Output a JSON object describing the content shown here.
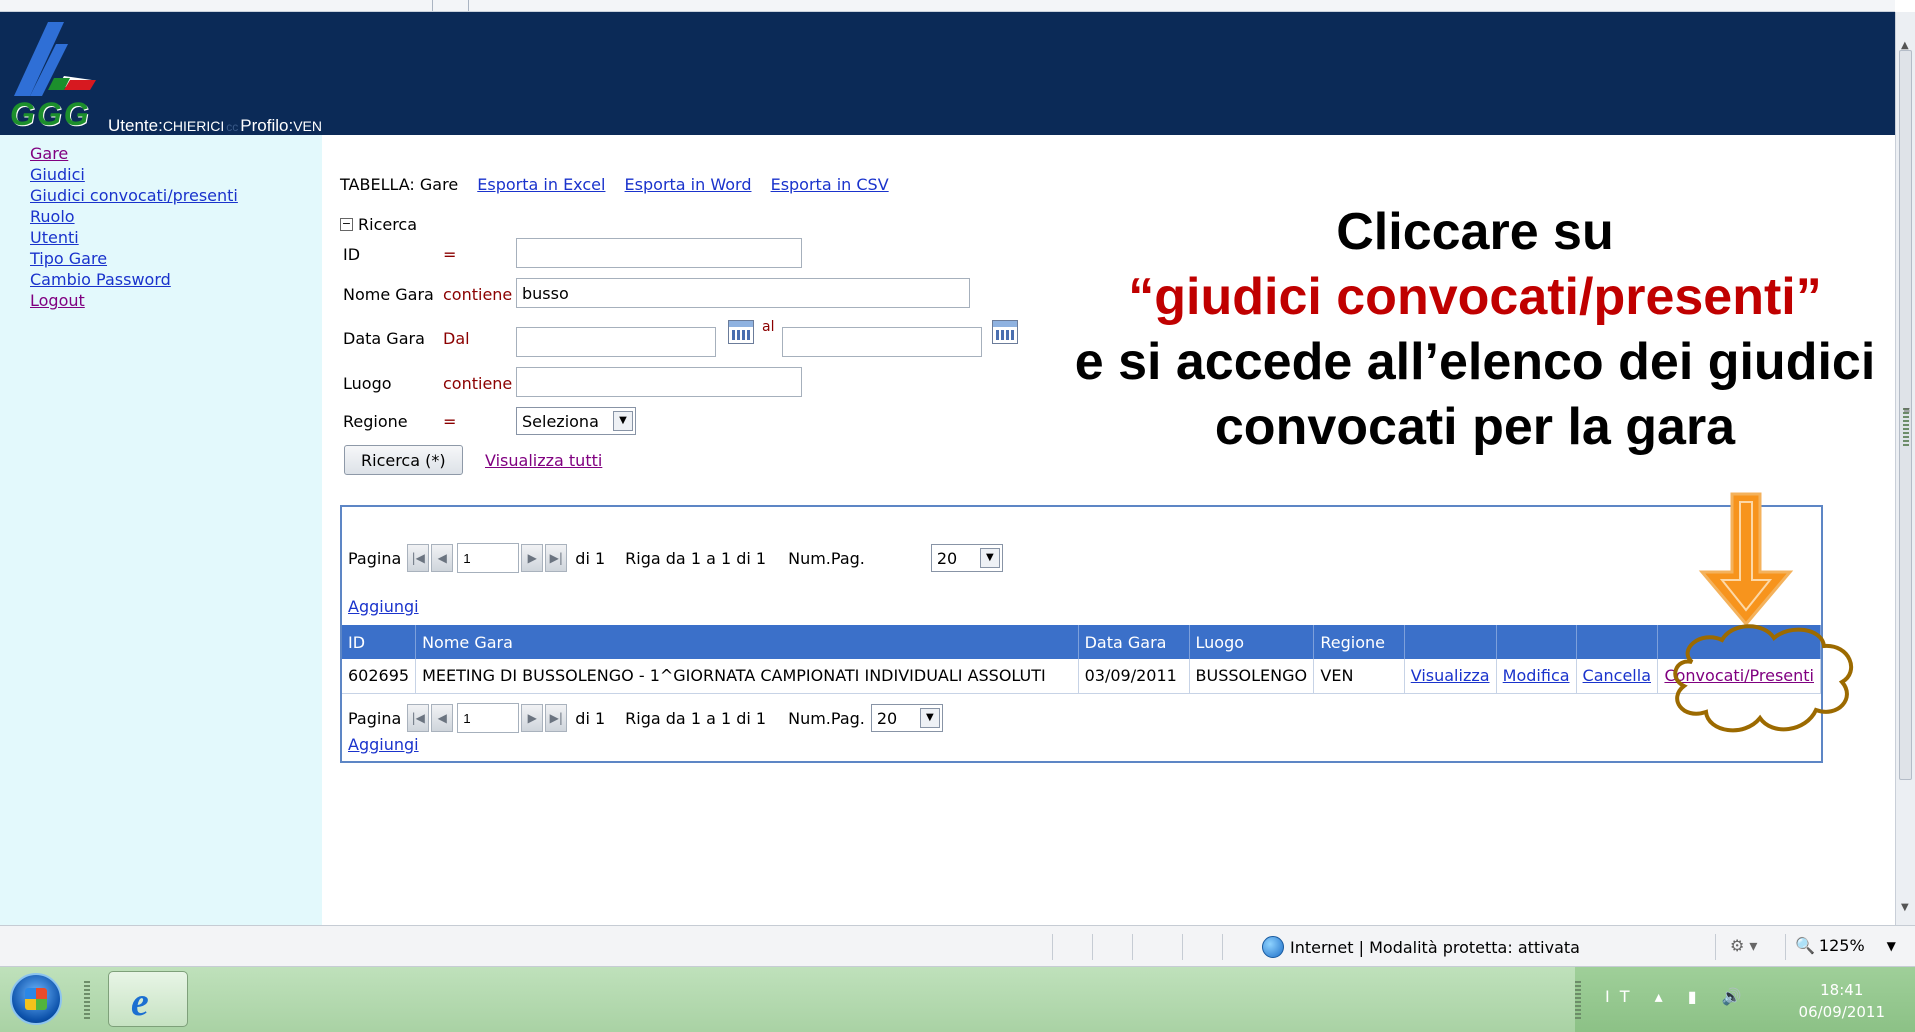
{
  "header": {
    "logo_text": "GGG",
    "user_label": "Utente:",
    "user_value": "CHIERICI",
    "user_suffix": "cc",
    "profile_label": "Profilo:",
    "profile_value": "VEN"
  },
  "nav": {
    "items": [
      "Gare",
      "Giudici",
      "Giudici convocati/presenti",
      "Ruolo",
      "Utenti",
      "Tipo Gare",
      "Cambio Password",
      "Logout"
    ]
  },
  "table_bar": {
    "label": "TABELLA: Gare",
    "export_excel": "Esporta in Excel",
    "export_word": "Esporta in Word",
    "export_csv": "Esporta in CSV"
  },
  "search": {
    "toggle_label": "Ricerca",
    "id_label": "ID",
    "id_op": "=",
    "id_value": "",
    "nome_label": "Nome Gara",
    "nome_op": "contiene",
    "nome_value": "busso",
    "data_label": "Data Gara",
    "data_op": "Dal",
    "data_from": "",
    "data_to_label": "al",
    "data_to": "",
    "luogo_label": "Luogo",
    "luogo_op": "contiene",
    "luogo_value": "",
    "regione_label": "Regione",
    "regione_op": "=",
    "regione_value": "Seleziona",
    "search_button": "Ricerca (*)",
    "show_all": "Visualizza tutti"
  },
  "pager": {
    "label": "Pagina",
    "page": "1",
    "of": "di 1",
    "rows": "Riga da 1 a 1 di 1",
    "numpag_label": "Num.Pag.",
    "numpag_value": "20",
    "add_link": "Aggiungi"
  },
  "grid": {
    "columns": [
      "ID",
      "Nome Gara",
      "Data Gara",
      "Luogo",
      "Regione",
      "",
      "",
      "",
      ""
    ],
    "rows": [
      {
        "id": "602695",
        "nome": "MEETING DI BUSSOLENGO - 1^GIORNATA CAMPIONATI INDIVIDUALI ASSOLUTI",
        "data": "03/09/2011",
        "luogo": "BUSSOLENGO",
        "regione": "VEN",
        "view": "Visualizza",
        "edit": "Modifica",
        "delete": "Cancella",
        "convocati": "Convocati/Presenti"
      }
    ]
  },
  "annotation": {
    "line1": "Cliccare su",
    "line2": "“giudici convocati/presenti”",
    "line3": "e si accede all’elenco dei giudici",
    "line4": "convocati per la gara",
    "highlight_color": "#c00000",
    "arrow_color": "#f7941d",
    "cloud_color": "#9c6a00"
  },
  "status_bar": {
    "zone_text": "Internet | Modalità protetta: attivata",
    "zoom": "125%"
  },
  "taskbar": {
    "lang": "IT",
    "time": "18:41",
    "date": "06/09/2011"
  }
}
